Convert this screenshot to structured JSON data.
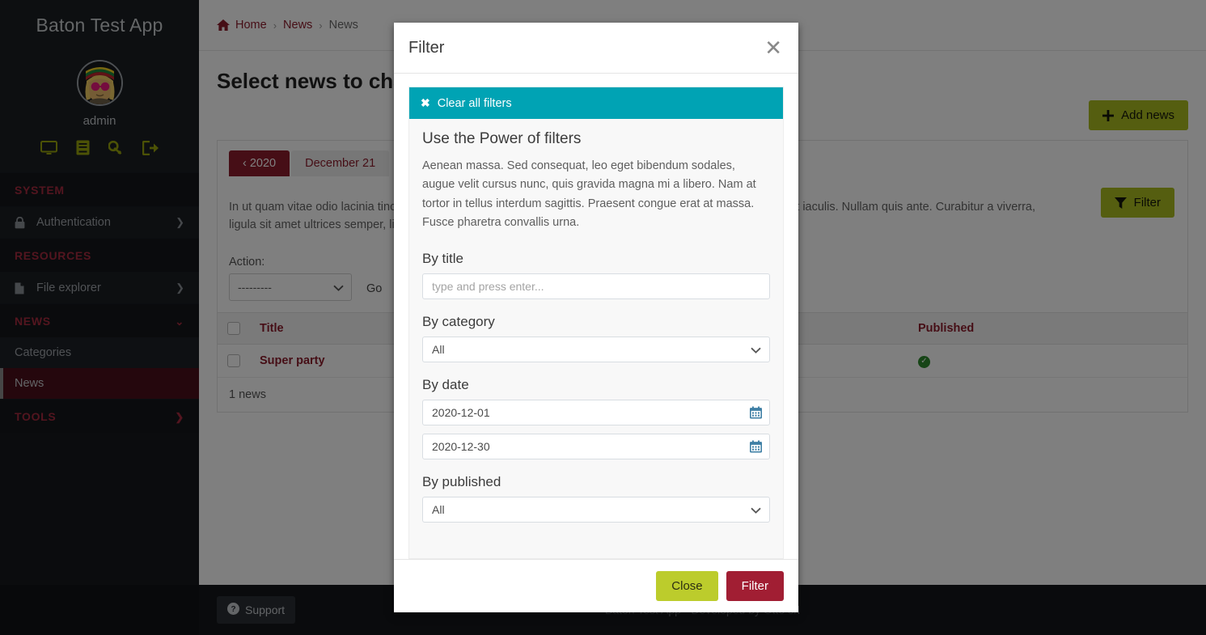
{
  "sidebar": {
    "brand": "Baton Test App",
    "username": "admin",
    "avatar_icon": "user-avatar",
    "quick_icons": [
      {
        "name": "desktop-icon",
        "label": "View site"
      },
      {
        "name": "docs-icon",
        "label": "Documentation"
      },
      {
        "name": "key-icon",
        "label": "Change password"
      },
      {
        "name": "logout-icon",
        "label": "Log out"
      }
    ],
    "sections": [
      {
        "label": "SYSTEM",
        "caret": "chevron-right"
      },
      {
        "label": "RESOURCES",
        "caret": ""
      },
      {
        "label": "NEWS",
        "caret": "chevron-down"
      },
      {
        "label": "TOOLS",
        "caret": "chevron-right"
      }
    ],
    "items": {
      "authentication": "Authentication",
      "file_explorer": "File explorer",
      "categories": "Categories",
      "news": "News"
    }
  },
  "breadcrumb": {
    "home": "Home",
    "level2": "News",
    "current": "News",
    "separator": "›"
  },
  "page": {
    "title": "Select news to change",
    "add_button": "Add news",
    "filter_button": "Filter"
  },
  "card": {
    "tabs": [
      {
        "label": "‹ 2020",
        "active": true
      },
      {
        "label": "December 21",
        "active": false
      }
    ],
    "description": "In ut quam vitae odio lacinia tincidunt. Vestibulum dapibus nunc ac augue. Praesent ac massa at ligula laoreet iaculis. Nullam quis ante. Curabitur a viverra, ligula sit amet ultrices semper, ligula arcu tristique sapien, a accumsan nisi mauris ac",
    "action_label": "Action:",
    "action_value": "---------",
    "go_label": "Go"
  },
  "table": {
    "columns": [
      "Title",
      "Published"
    ],
    "rows": [
      {
        "title": "Super party",
        "published": true
      }
    ],
    "count_text": "1 news"
  },
  "footer": {
    "support_label": "Support",
    "support_icon": "question-circle-icon",
    "credit": "Baton Test App · Developed by Otto srl"
  },
  "modal": {
    "title": "Filter",
    "close_icon": "close-icon",
    "clear_all": "Clear all filters",
    "clear_icon": "times-icon",
    "panel_heading": "Use the Power of filters",
    "panel_text": "Aenean massa. Sed consequat, leo eget bibendum sodales, augue velit cursus nunc, quis gravida magna mi a libero. Nam at tortor in tellus interdum sagittis. Praesent congue erat at massa. Fusce pharetra convallis urna.",
    "fields": {
      "title": {
        "label": "By title",
        "value": "",
        "placeholder": "type and press enter..."
      },
      "category": {
        "label": "By category",
        "value": "All"
      },
      "date": {
        "label": "By date",
        "from": "2020-12-01",
        "to": "2020-12-30",
        "icon": "calendar-icon"
      },
      "published": {
        "label": "By published",
        "value": "All"
      }
    },
    "buttons": {
      "close": "Close",
      "apply": "Filter"
    }
  },
  "colors": {
    "accent_red": "#8d1d2c",
    "olive": "#aabd21",
    "teal": "#00a3b4",
    "modal_apply": "#a11e33",
    "modal_close": "#bccc2c",
    "published_ok": "#2e8b2e"
  }
}
